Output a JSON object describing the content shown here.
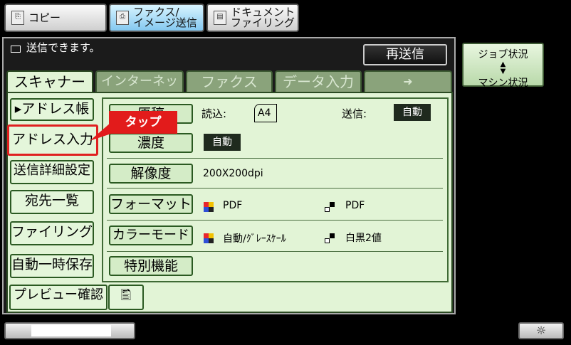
{
  "modes": {
    "copy": "コピー",
    "fax_line1": "ファクス/",
    "fax_line2": "イメージ送信",
    "doc_line1": "ドキュメント",
    "doc_line2": "ファイリング"
  },
  "status_message": "送信できます。",
  "resend_label": "再送信",
  "job_status": {
    "line1": "ジョブ状況",
    "line2": "マシン状況"
  },
  "tabs": [
    "スキャナー",
    "インターネットFax",
    "ファクス",
    "データ入力",
    "➜"
  ],
  "left_buttons": {
    "address_book": "▸アドレス帳",
    "address_entry": "アドレス入力",
    "send_settings": "送信詳細設定",
    "dest_list": "宛先一覧",
    "filing": "ファイリング",
    "quick_save": "自動一時保存",
    "preview": "プレビュー確認"
  },
  "callout_label": "タップ",
  "settings": {
    "original_label": "原稿",
    "read_label": "読込:",
    "read_value": "A4",
    "send_label": "送信:",
    "send_value": "自動",
    "density_label": "濃度",
    "density_value": "自動",
    "resolution_label": "解像度",
    "resolution_value": "200X200dpi",
    "format_label": "フォーマット",
    "format_color_value": "PDF",
    "format_bw_value": "PDF",
    "color_mode_label": "カラーモード",
    "color_mode_color_value": "自動/ｸﾞﾚｰｽｹｰﾙ",
    "color_mode_bw_value": "白黒2値",
    "special_label": "特別機能"
  },
  "colors": {
    "panel_green": "#e2f4d6",
    "button_border": "#2b5a22",
    "highlight": "#e02020"
  }
}
